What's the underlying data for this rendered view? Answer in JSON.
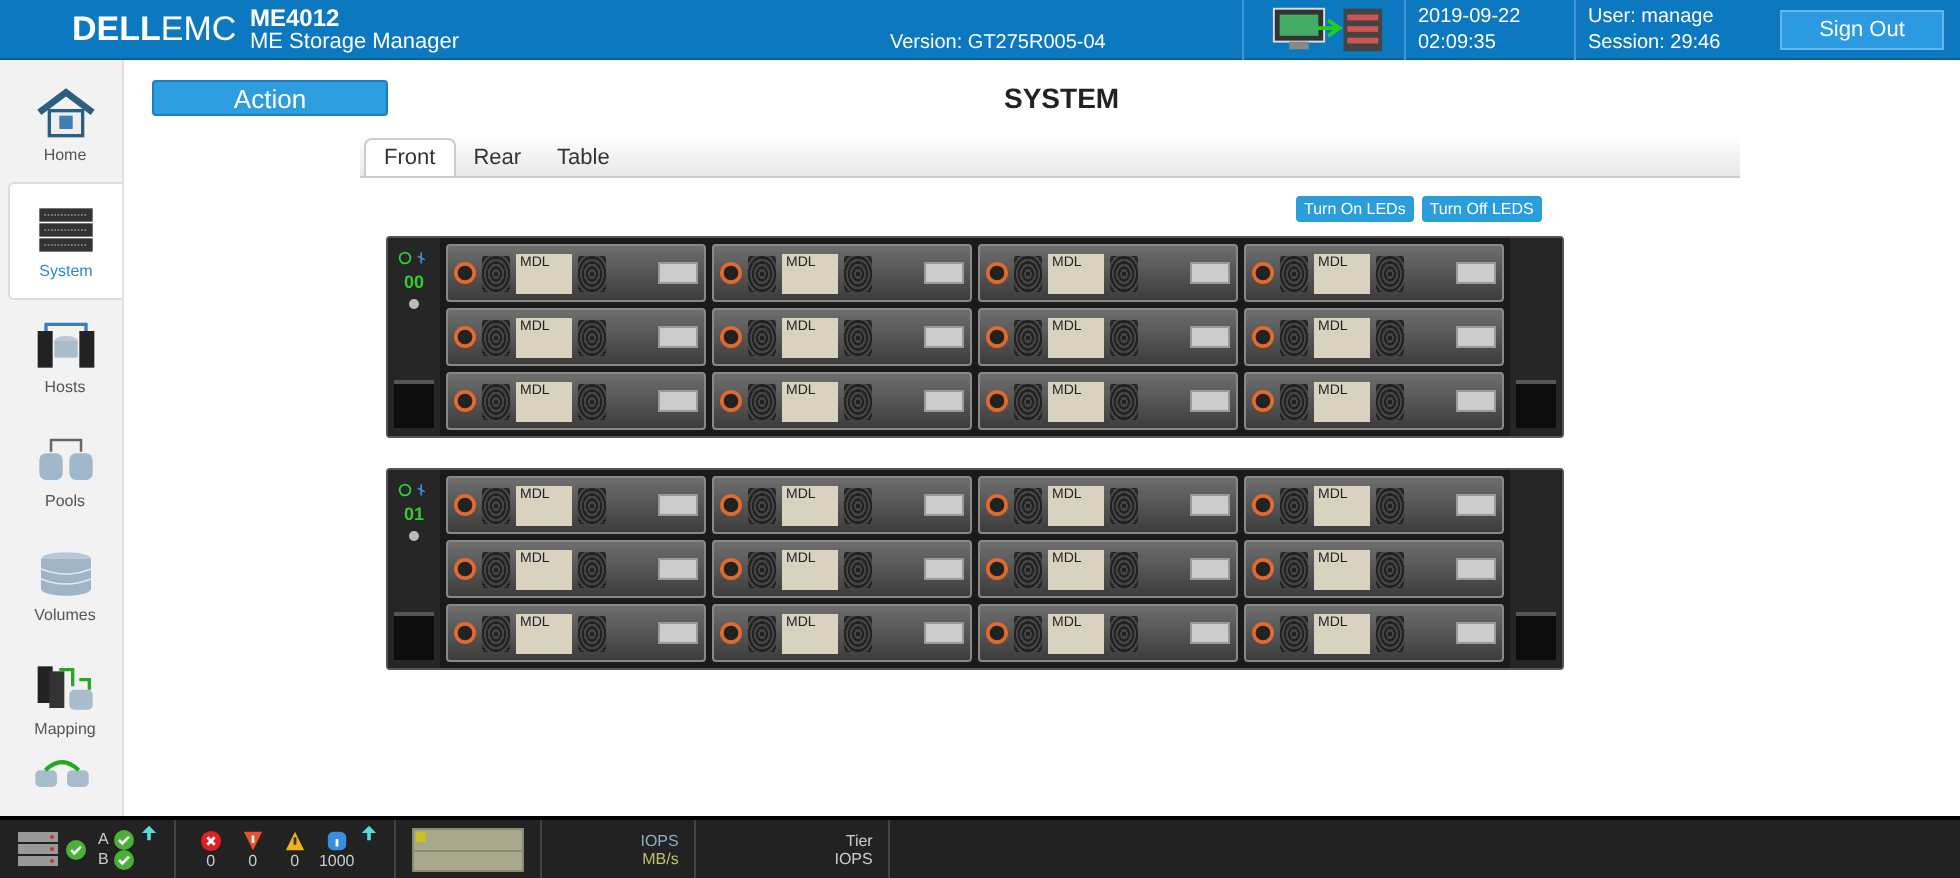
{
  "header": {
    "logo": "**DELL**EMC",
    "model": "ME4012",
    "product": "ME Storage Manager",
    "version": "Version: GT275R005-04",
    "date": "2019-09-22",
    "time": "02:09:35",
    "user": "User: manage",
    "session": "Session: 29:46",
    "sign_out": "Sign Out"
  },
  "sidebar": {
    "items": [
      {
        "label": "Home",
        "kind": "home",
        "selected": false
      },
      {
        "label": "System",
        "kind": "system",
        "selected": true
      },
      {
        "label": "Hosts",
        "kind": "hosts",
        "selected": false
      },
      {
        "label": "Pools",
        "kind": "pools",
        "selected": false
      },
      {
        "label": "Volumes",
        "kind": "volumes",
        "selected": false
      },
      {
        "label": "Mapping",
        "kind": "mapping",
        "selected": false
      }
    ]
  },
  "action_button": "Action",
  "title": "SYSTEM",
  "tabs": [
    {
      "label": "Front",
      "selected": true
    },
    {
      "label": "Rear",
      "selected": false
    },
    {
      "label": "Table",
      "selected": false
    }
  ],
  "led_buttons": [
    "Turn On LEDs",
    "Turn Off LEDS"
  ],
  "enclosures": [
    {
      "id": "00",
      "drives": [
        "MDL",
        "MDL",
        "MDL",
        "MDL",
        "MDL",
        "MDL",
        "MDL",
        "MDL",
        "MDL",
        "MDL",
        "MDL",
        "MDL"
      ]
    },
    {
      "id": "01",
      "drives": [
        "MDL",
        "MDL",
        "MDL",
        "MDL",
        "MDL",
        "MDL",
        "MDL",
        "MDL",
        "MDL",
        "MDL",
        "MDL",
        "MDL"
      ]
    }
  ],
  "status_bar": {
    "controllers": [
      {
        "label": "A",
        "ok": true
      },
      {
        "label": "B",
        "ok": true
      }
    ],
    "events": [
      {
        "kind": "error",
        "count": "0"
      },
      {
        "kind": "critical",
        "count": "0"
      },
      {
        "kind": "warning",
        "count": "0"
      },
      {
        "kind": "info",
        "count": "1000"
      }
    ],
    "perf": [
      "IOPS",
      "MB/s"
    ],
    "tier": [
      "Tier",
      "IOPS"
    ]
  }
}
